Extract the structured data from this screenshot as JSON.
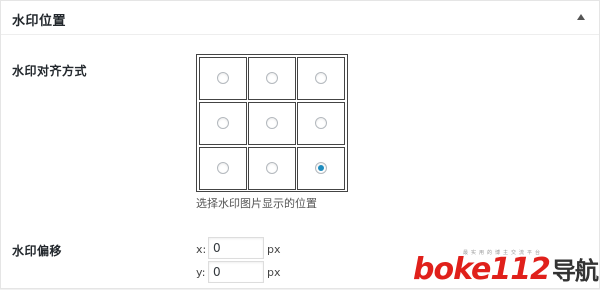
{
  "panel": {
    "title": "水印位置",
    "toggle_icon": "triangle-up-icon"
  },
  "alignment": {
    "label": "水印对齐方式",
    "hint": "选择水印图片显示的位置",
    "positions": [
      {
        "id": "top-left",
        "checked": false
      },
      {
        "id": "top-center",
        "checked": false
      },
      {
        "id": "top-right",
        "checked": false
      },
      {
        "id": "middle-left",
        "checked": false
      },
      {
        "id": "middle-center",
        "checked": false
      },
      {
        "id": "middle-right",
        "checked": false
      },
      {
        "id": "bottom-left",
        "checked": false
      },
      {
        "id": "bottom-center",
        "checked": false
      },
      {
        "id": "bottom-right",
        "checked": true
      }
    ]
  },
  "offset": {
    "label": "水印偏移",
    "x_label": "x:",
    "x_value": "0",
    "y_label": "y:",
    "y_value": "0",
    "unit": "px"
  },
  "watermark": {
    "brand": "boke112",
    "brand_cn": "导航",
    "tagline": "最实用的博主交流平台"
  },
  "colors": {
    "accent": "#1e8cbe",
    "logo_red": "#e0201b"
  }
}
